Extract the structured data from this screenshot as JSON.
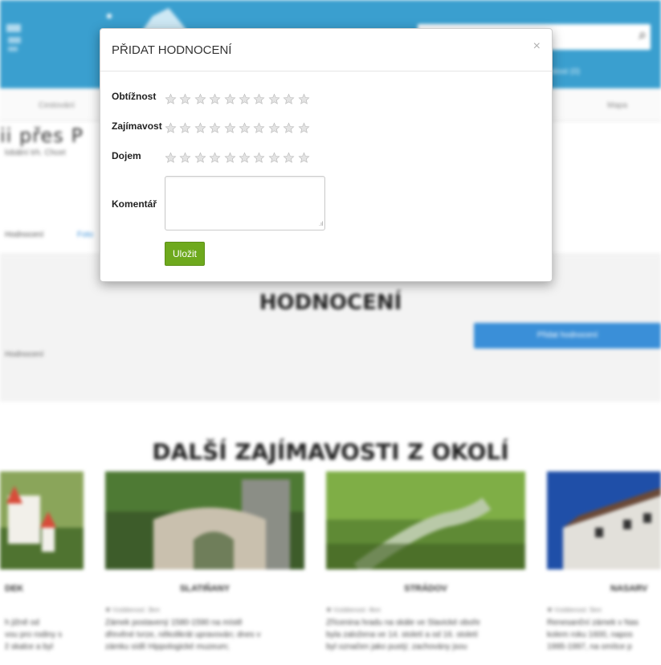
{
  "modal": {
    "title": "PŘIDAT HODNOCENÍ",
    "close": "×",
    "fields": [
      {
        "label": "Obtížnost",
        "stars": 10,
        "rating": 0
      },
      {
        "label": "Zajímavost",
        "stars": 10,
        "rating": 0
      },
      {
        "label": "Dojem",
        "stars": 10,
        "rating": 0
      }
    ],
    "comment_label": "Komentář",
    "comment_value": "",
    "save_label": "Uložit"
  },
  "background": {
    "cart": "álost (0)",
    "nav": [
      "Cestování",
      "Mapa"
    ],
    "page_heading": "ii přes P",
    "location": "lobální trh. Chcet",
    "tabs": [
      "Hodnocení",
      "Foto"
    ],
    "section_title": "HODNOCENÍ",
    "add_rating_button": "Přidat hodnocení",
    "ratings_text": "Hodnocení",
    "nearby_title": "DALŠÍ ZAJÍMAVOSTI Z OKOLÍ",
    "cards": [
      {
        "title": "DEK",
        "dist": "",
        "text": "h jižně od\nvou pro rodiny s\nž skalce a byl"
      },
      {
        "title": "SLATIŇANY",
        "dist": "✱ Vzdálenost: 3km",
        "text": "Zámek postavený 1580-1590 na místě\ndřevěné tvrze, několikrát upravován; dnes v\nzámku sídlí Hippologické muzeum;"
      },
      {
        "title": "STRÁDOV",
        "dist": "✱ Vzdálenost: 4km",
        "text": "Zřícenina hradu na skále ve Slavické oboře\nbyla založena ve 14. století a od 16. století\nbyl označen jako pustý; zachovány jsou"
      },
      {
        "title": "NASARV",
        "dist": "✱ Vzdálenost: 5km",
        "text": "Renesanční zámek v Nas\nkolem roku 1600, napos\n1995-1997, na omítce p"
      }
    ]
  },
  "colors": {
    "header_blue": "#3a9fcf",
    "button_blue": "#3a8fd8",
    "save_green": "#6ea91d"
  }
}
